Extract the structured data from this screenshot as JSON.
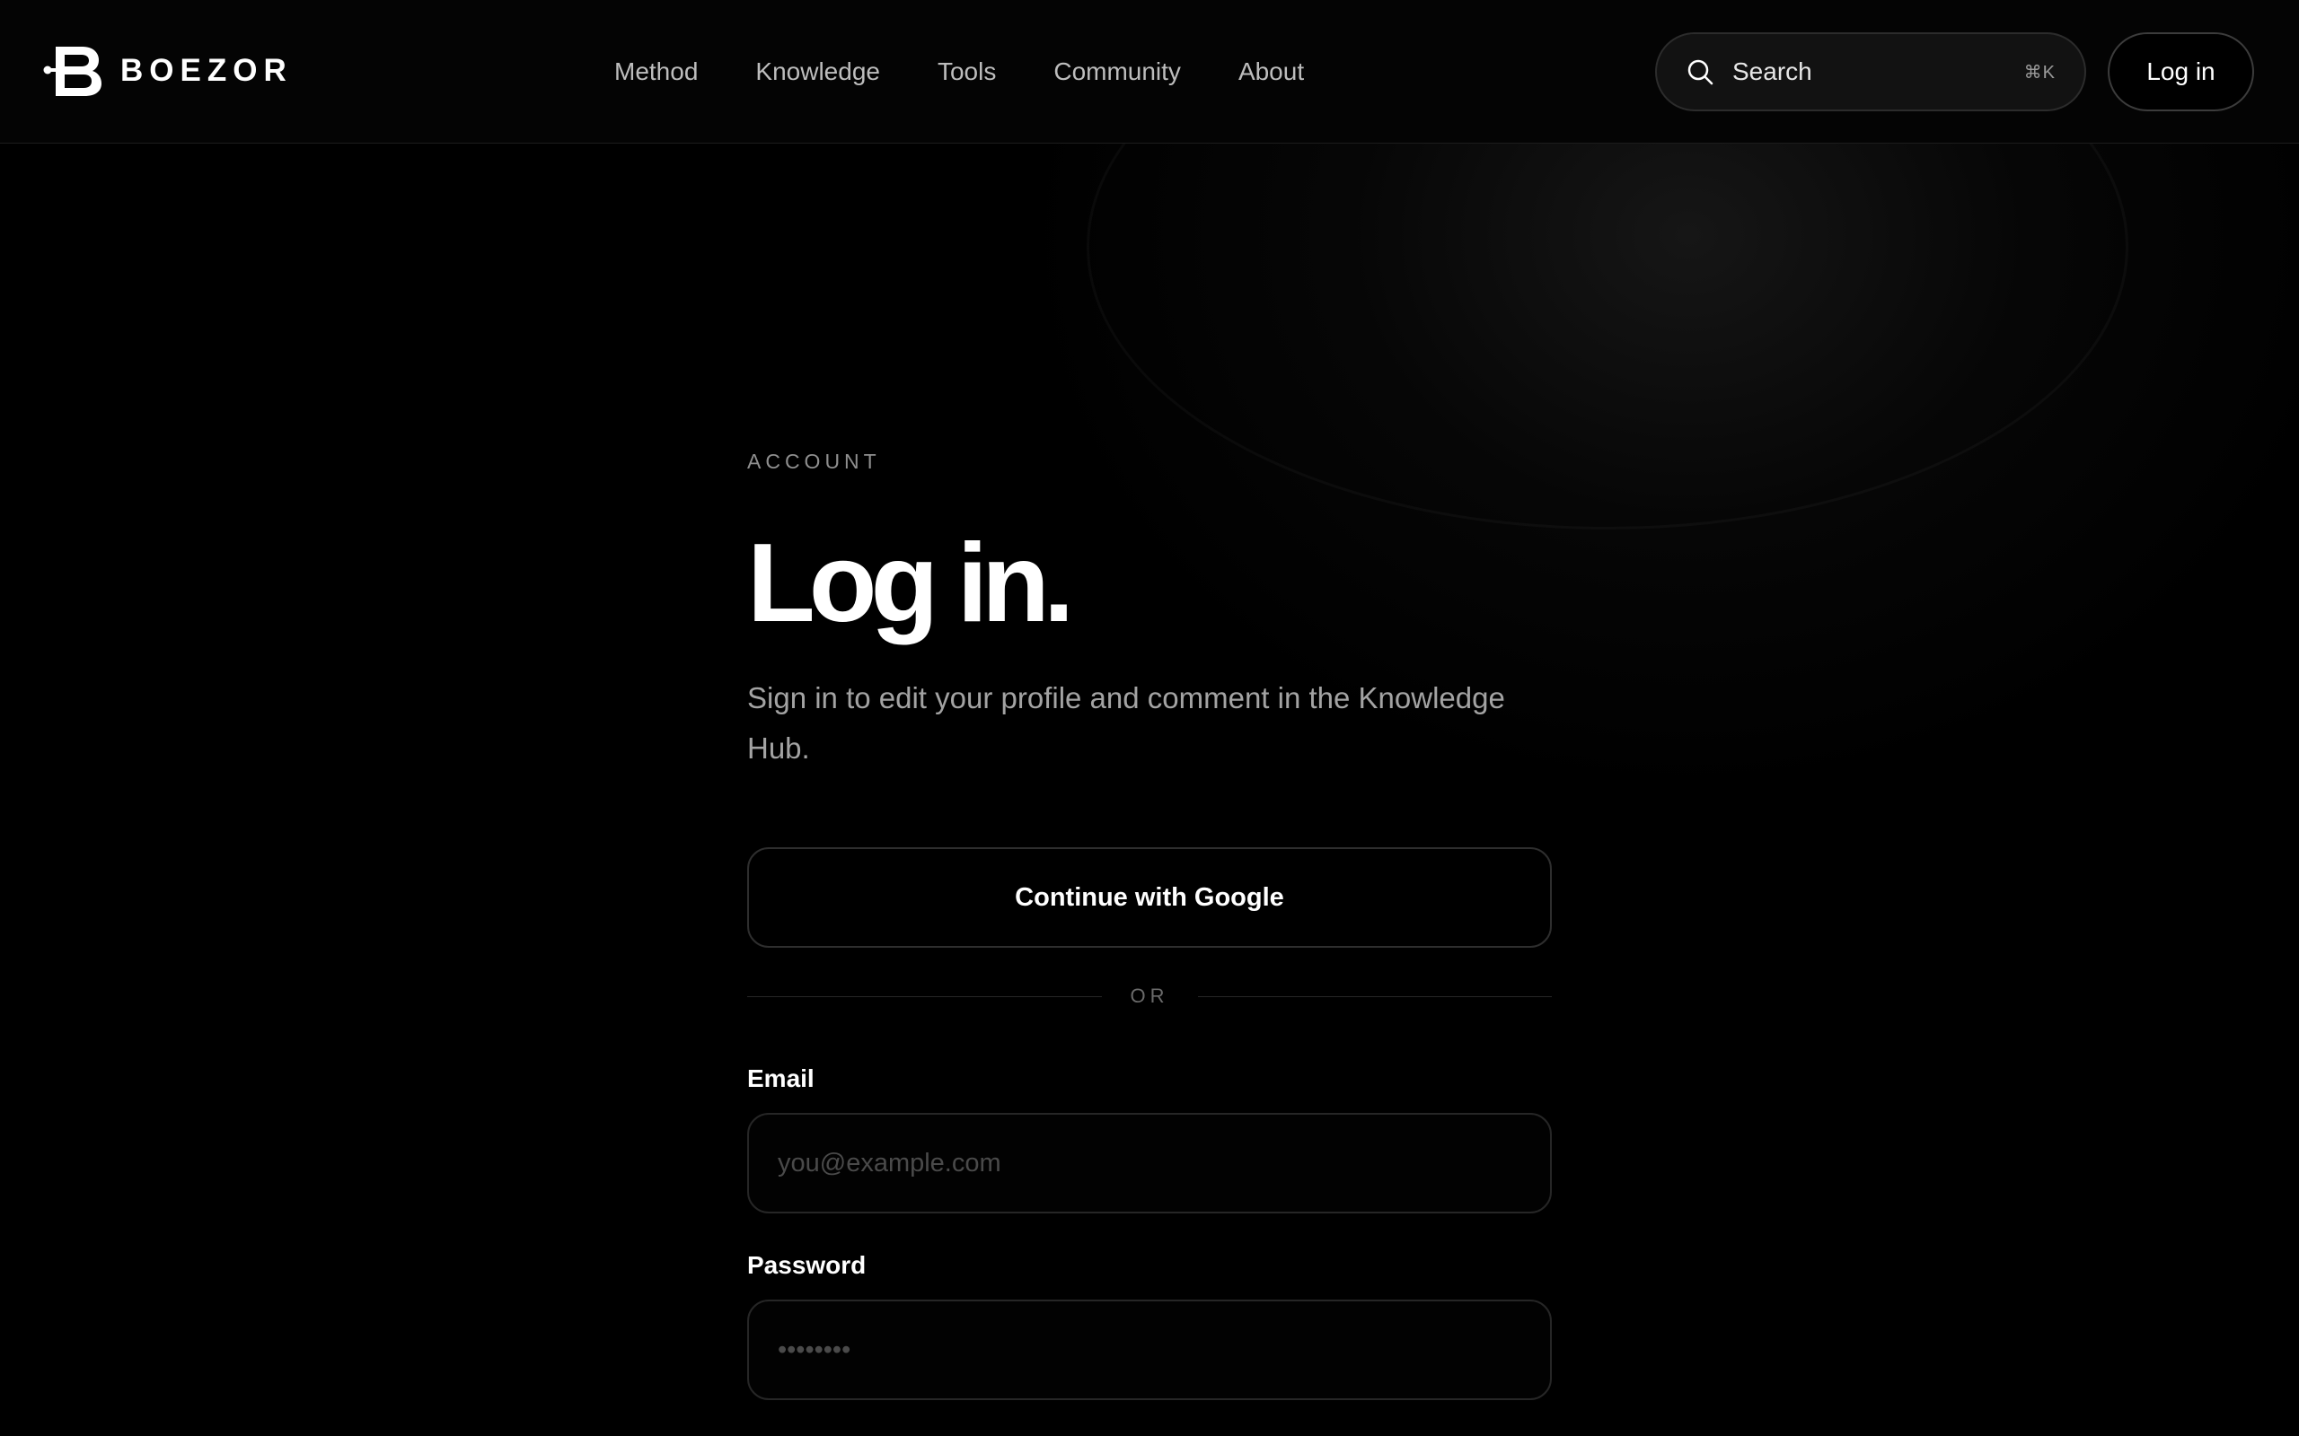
{
  "brand": {
    "name": "BOEZOR"
  },
  "nav": {
    "items": [
      {
        "label": "Method"
      },
      {
        "label": "Knowledge"
      },
      {
        "label": "Tools"
      },
      {
        "label": "Community"
      },
      {
        "label": "About"
      }
    ]
  },
  "search": {
    "label": "Search",
    "shortcut": "⌘K",
    "icon": "search-icon"
  },
  "header": {
    "login_label": "Log in"
  },
  "page": {
    "eyebrow": "ACCOUNT",
    "title": "Log in.",
    "subtitle": "Sign in to edit your profile and comment in the Knowledge Hub."
  },
  "form": {
    "google_button": "Continue with Google",
    "divider": "OR",
    "email": {
      "label": "Email",
      "placeholder": "you@example.com",
      "value": ""
    },
    "password": {
      "label": "Password",
      "placeholder": "••••••••",
      "value": ""
    }
  },
  "colors": {
    "background": "#000000",
    "text": "#ffffff",
    "muted": "#a3a3a3",
    "border": "#2e2e2e"
  }
}
